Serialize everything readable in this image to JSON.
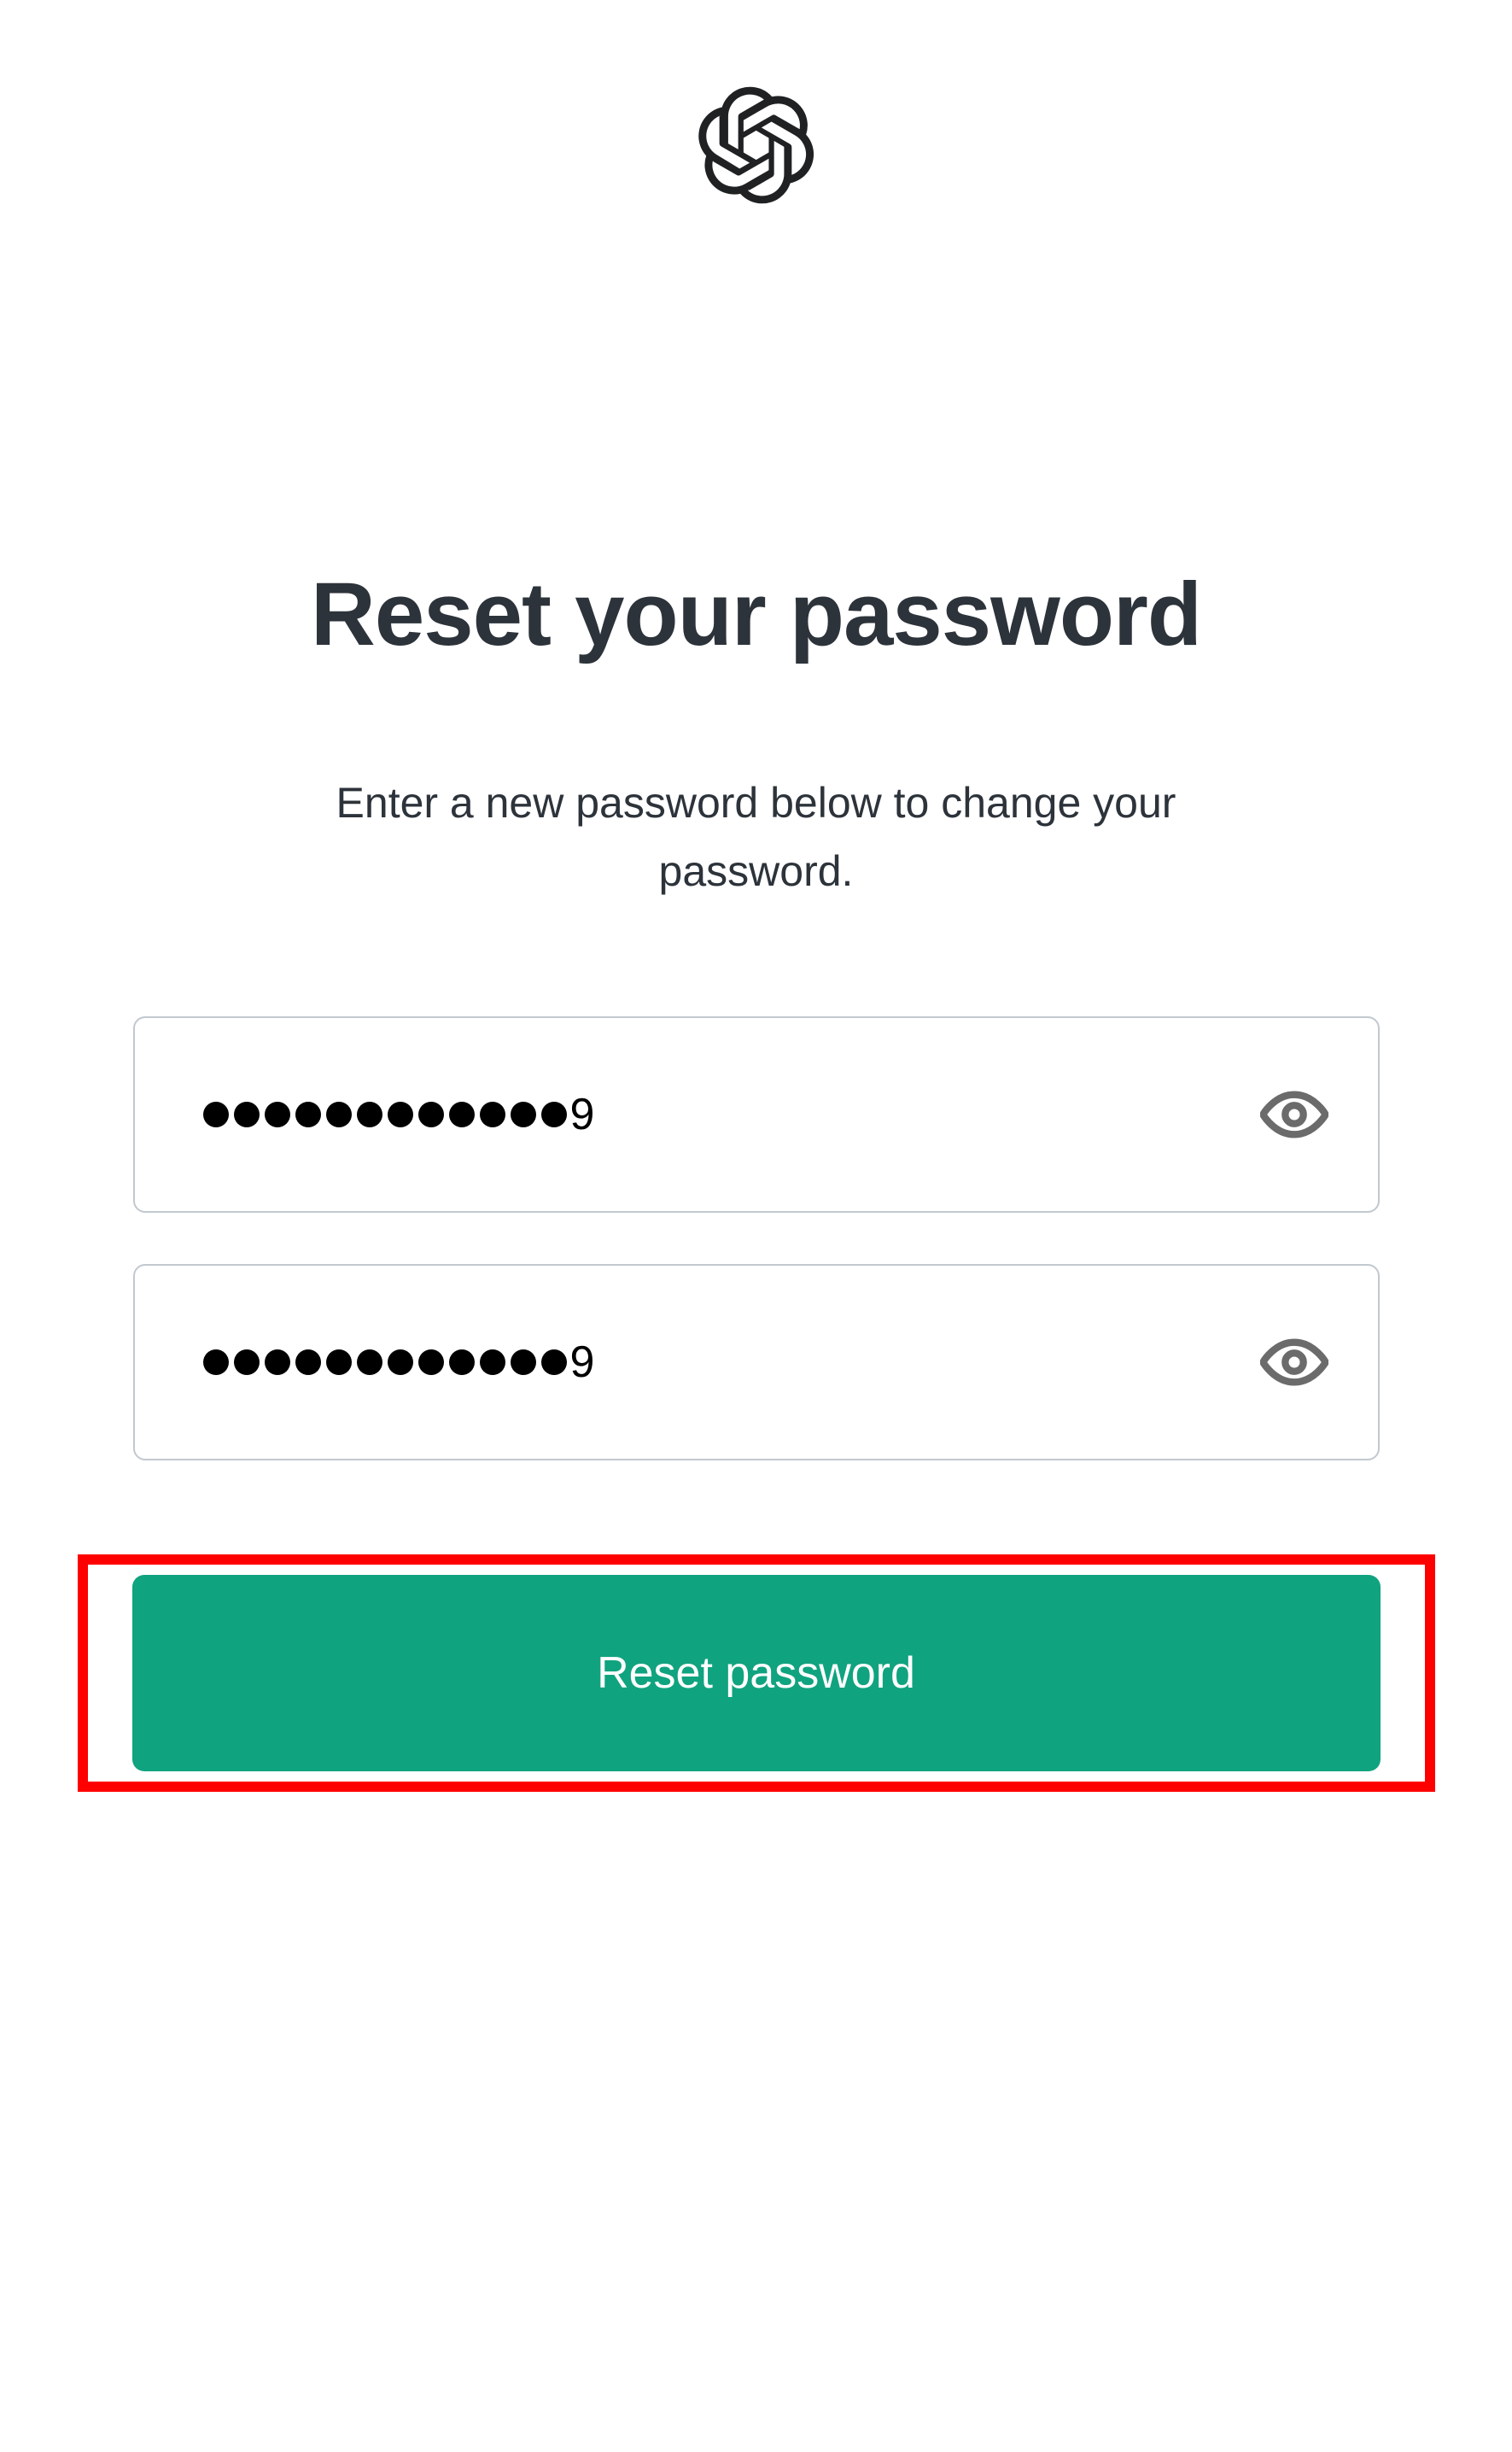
{
  "header": {
    "title": "Reset your password",
    "subtitle": "Enter a new password below to change your password."
  },
  "fields": {
    "password": {
      "masked_count": 12,
      "visible_suffix": "9"
    },
    "confirm_password": {
      "masked_count": 12,
      "visible_suffix": "9"
    }
  },
  "button": {
    "label": "Reset password"
  },
  "colors": {
    "primary": "#10a37f",
    "highlight": "#ff0000"
  }
}
